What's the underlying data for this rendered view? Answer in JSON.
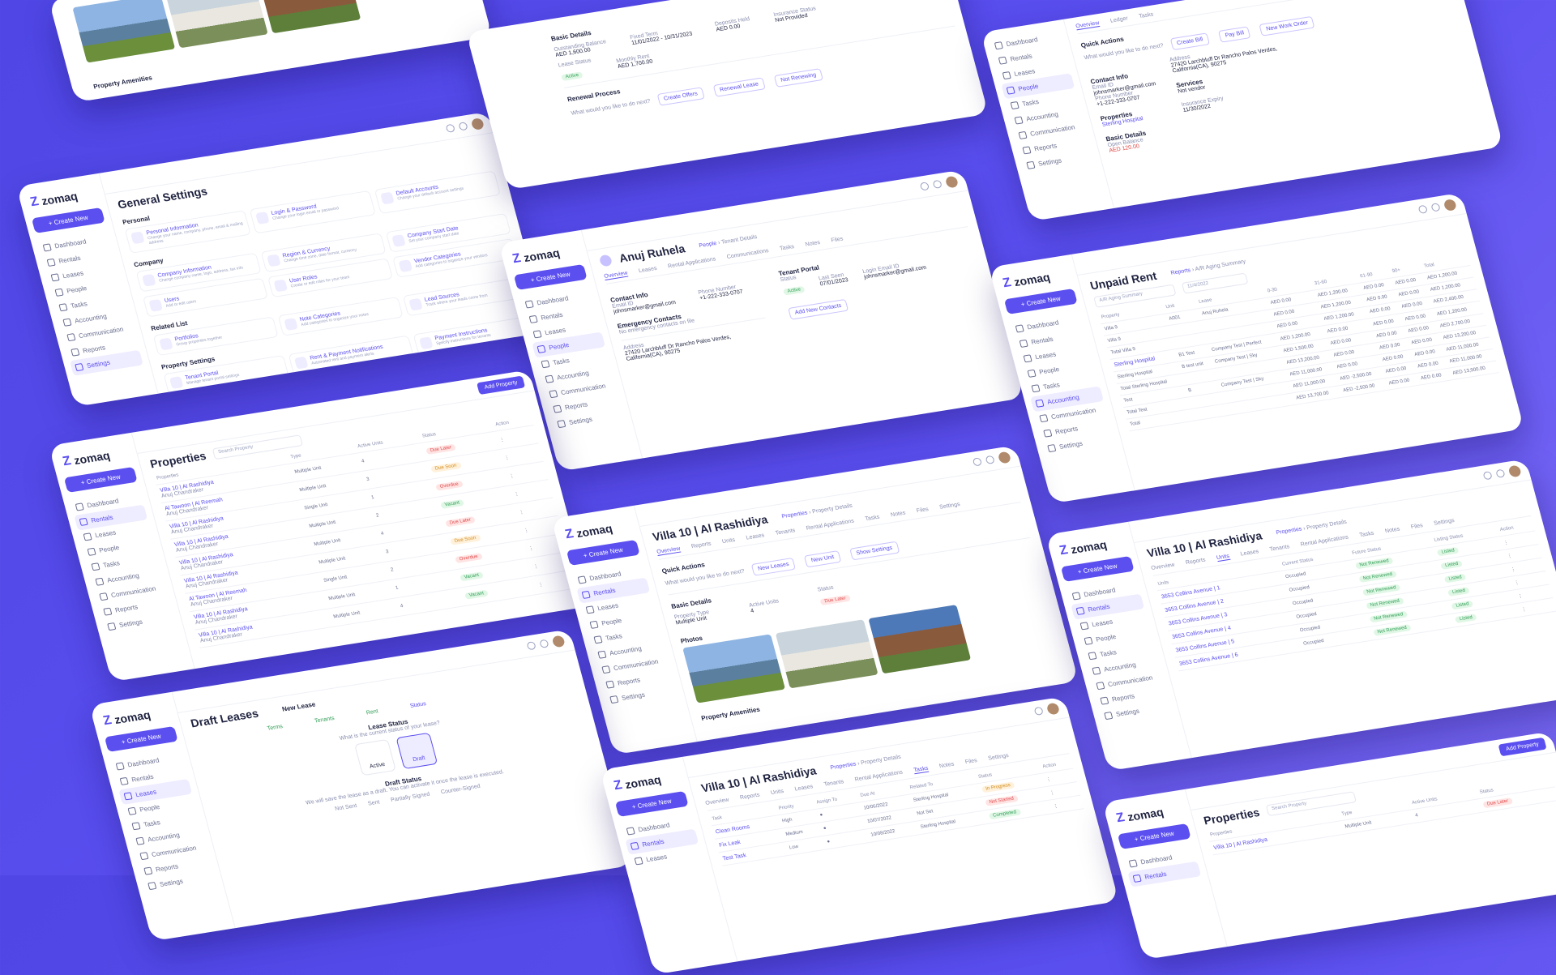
{
  "brand": {
    "name": "zomaq",
    "cta": "+ Create New"
  },
  "nav": [
    "Dashboard",
    "Rentals",
    "Leases",
    "People",
    "Tasks",
    "Accounting",
    "Communication",
    "Reports",
    "Settings"
  ],
  "general_settings": {
    "title": "General Settings",
    "personal": "Personal",
    "company": "Company",
    "related": "Related List",
    "property": "Property Settings",
    "tiles": [
      {
        "t": "Personal Information",
        "d": "Change your name, company, phone, email & mailing address"
      },
      {
        "t": "Login & Password",
        "d": "Change your login email or password"
      },
      {
        "t": "Default Accounts",
        "d": "Change your default account settings"
      },
      {
        "t": "Company Information",
        "d": "Change company name, logo, address, tax info"
      },
      {
        "t": "Region & Currency",
        "d": "Change time zone, date format, currency"
      },
      {
        "t": "Company Start Date",
        "d": "Set your company start date"
      },
      {
        "t": "Users",
        "d": "Add or edit users"
      },
      {
        "t": "User Roles",
        "d": "Create or edit roles for your team"
      },
      {
        "t": "Vendor Categories",
        "d": "Add categories to organize your vendors"
      },
      {
        "t": "Portfolios",
        "d": "Group properties together"
      },
      {
        "t": "Note Categories",
        "d": "Add categories to organize your notes"
      },
      {
        "t": "Lead Sources",
        "d": "Track where your leads come from"
      },
      {
        "t": "Tenant Portal",
        "d": "Manage tenant portal settings"
      },
      {
        "t": "Rent & Payment Notifications",
        "d": "Automated rent and payment alerts"
      },
      {
        "t": "Payment Instructions",
        "d": "Specify instructions for tenants"
      }
    ]
  },
  "renewal": {
    "basic": "Basic Details",
    "outstanding_label": "Outstanding Balance",
    "outstanding": "AED 1,600.00",
    "fixed_term_label": "Fixed Term",
    "fixed_term": "11/01/2022 - 10/31/2023",
    "rent_label": "Monthly Rent",
    "rent": "AED 1,700.00",
    "deposit_label": "Deposits Held",
    "deposit": "AED 0.00",
    "insurance_label": "Insurance Status",
    "insurance": "Not Provided",
    "lease_status_label": "Lease Status",
    "lease_status": "Active",
    "renewal_title": "Renewal Process",
    "question": "What would you like to do next?",
    "actions": [
      "Create Offers",
      "Renewal Lease",
      "Not Renewing"
    ]
  },
  "tenant_quick": {
    "tabs": [
      "Overview",
      "Ledger",
      "Tasks"
    ],
    "quick": "Quick Actions",
    "question": "What would you like to do next?",
    "actions": [
      "Create Bill",
      "Pay Bill",
      "New Work Order"
    ],
    "contact": "Contact Info",
    "email_label": "Email ID",
    "email": "johnsmarker@gmail.com",
    "phone_label": "Phone Number",
    "phone": "+1-222-333-0707",
    "address_label": "Address",
    "address": "27420 Larchbluff Dr Rancho Palos Verdes, California(CA), 90275",
    "services": "Services",
    "services_val": "Not vendor",
    "properties": "Properties",
    "property": "Sterling Hospital",
    "basic": "Basic Details",
    "opening_label": "Open Balance",
    "opening": "AED 120.00",
    "ins_label": "Insurance Expiry",
    "ins": "11/30/2022"
  },
  "person": {
    "name": "Anuj Ruhela",
    "crumb_a": "People",
    "crumb_b": "Tenant Details",
    "tabs": [
      "Overview",
      "Leases",
      "Rental Applications",
      "Communications",
      "Tasks",
      "Notes",
      "Files"
    ],
    "contact": "Contact Info",
    "email_label": "Email ID",
    "email": "johnsmarker@gmail.com",
    "phone_label": "Phone Number",
    "phone": "+1-222-333-0707",
    "portal": "Tenant Portal",
    "status_label": "Status",
    "status": "Active",
    "last_seen_label": "Last Seen",
    "last_seen": "07/01/2023",
    "login_label": "Login Email ID",
    "login": "johnsmarker@gmail.com",
    "add_contact": "Add New Contacts",
    "emergency": "Emergency Contacts",
    "emergency_empty": "No emergency contacts on file",
    "address_label": "Address",
    "address": "27420 Larchbluff Dr Rancho Palos Verdes, California(CA), 90275"
  },
  "unpaid": {
    "title": "Unpaid Rent",
    "crumb_a": "Reports",
    "crumb_b": "A/R Aging Summary",
    "filter": "A/R Aging Summary",
    "date": "11/4/2022",
    "cols": [
      "Property",
      "Unit",
      "Lease",
      "0-30",
      "31-60",
      "61-90",
      "90+",
      "Total"
    ],
    "rows": [
      [
        "Villa 9",
        "A001",
        "Anuj Ruhela",
        "AED 0.00",
        "AED 1,200.00",
        "AED 0.00",
        "AED 0.00",
        "AED 1,200.00"
      ],
      [
        "Villa 9",
        "",
        "",
        "AED 0.00",
        "AED 1,200.00",
        "AED 0.00",
        "AED 0.00",
        "AED 1,200.00"
      ],
      [
        "Total Villa 9",
        "",
        "",
        "AED 0.00",
        "AED 1,200.00",
        "AED 0.00",
        "AED 0.00",
        "AED 2,400.00"
      ],
      [
        "Sterling Hospital",
        "B1 Test",
        "Company Test | Perfect",
        "AED 1,200.00",
        "AED 0.00",
        "AED 0.00",
        "AED 0.00",
        "AED 1,200.00"
      ],
      [
        "Sterling Hospital",
        "B test unit",
        "Company Test | Sky",
        "AED 1,500.00",
        "AED 0.00",
        "AED 0.00",
        "AED 0.00",
        "AED 2,700.00"
      ],
      [
        "Total Sterling Hospital",
        "",
        "",
        "AED 13,200.00",
        "AED 0.00",
        "AED 0.00",
        "AED 0.00",
        "AED 13,200.00"
      ],
      [
        "Test",
        "B",
        "Company Test | Sky",
        "AED 11,000.00",
        "AED 0.00",
        "AED 0.00",
        "AED 0.00",
        "AED 11,000.00"
      ],
      [
        "Total Test",
        "",
        "",
        "AED 11,000.00",
        "AED -2,500.00",
        "AED 0.00",
        "AED 0.00",
        "AED 11,000.00"
      ],
      [
        "Total",
        "",
        "",
        "AED 13,700.00",
        "AED -2,500.00",
        "AED 0.00",
        "AED 0.00",
        "AED 13,900.00"
      ]
    ]
  },
  "properties": {
    "title": "Properties",
    "search": "Search Property",
    "add": "Add Property",
    "cols": [
      "Properties",
      "Type",
      "Active Units",
      "Status",
      "Action"
    ],
    "rows": [
      {
        "name": "Villa 10 | Al Rashidiya",
        "sub": "Anuj Chandraker",
        "type": "Multiple Unit",
        "units": "4",
        "status": "Due Later",
        "tone": "red"
      },
      {
        "name": "Al Tawoon | Al Reemah",
        "sub": "Anuj Chandraker",
        "type": "Multiple Unit",
        "units": "3",
        "status": "Due Soon",
        "tone": "amb"
      },
      {
        "name": "Villa 10 | Al Rashidiya",
        "sub": "Anuj Chandraker",
        "type": "Single Unit",
        "units": "1",
        "status": "Overdue",
        "tone": "red"
      },
      {
        "name": "Villa 10 | Al Rashidiya",
        "sub": "Anuj Chandraker",
        "type": "Multiple Unit",
        "units": "2",
        "status": "Vacant",
        "tone": "green"
      },
      {
        "name": "Villa 10 | Al Rashidiya",
        "sub": "Anuj Chandraker",
        "type": "Multiple Unit",
        "units": "4",
        "status": "Due Later",
        "tone": "red"
      },
      {
        "name": "Villa 10 | Al Rashidiya",
        "sub": "Anuj Chandraker",
        "type": "Multiple Unit",
        "units": "3",
        "status": "Due Soon",
        "tone": "amb"
      },
      {
        "name": "Al Tawoon | Al Reemah",
        "sub": "Anuj Chandraker",
        "type": "Single Unit",
        "units": "2",
        "status": "Overdue",
        "tone": "red"
      },
      {
        "name": "Villa 10 | Al Rashidiya",
        "sub": "Anuj Chandraker",
        "type": "Multiple Unit",
        "units": "1",
        "status": "Vacant",
        "tone": "green"
      },
      {
        "name": "Villa 10 | Al Rashidiya",
        "sub": "Anuj Chandraker",
        "type": "Multiple Unit",
        "units": "4",
        "status": "Vacant",
        "tone": "green"
      }
    ]
  },
  "villa": {
    "title": "Villa 10 | Al Rashidiya",
    "crumb_a": "Properties",
    "crumb_b": "Property Details",
    "tabs": [
      "Overview",
      "Reports",
      "Units",
      "Leases",
      "Tenants",
      "Rental Applications",
      "Tasks",
      "Notes",
      "Files",
      "Settings"
    ],
    "quick": "Quick Actions",
    "question": "What would you like to do next?",
    "actions": [
      "New Leases",
      "New Unit",
      "Show Settings"
    ],
    "basic": "Basic Details",
    "active_units_label": "Active Units",
    "active_units": "4",
    "status_label": "Status",
    "status": "Due Later",
    "type_label": "Property Type",
    "type": "Multiple Unit",
    "photos": "Photos",
    "amenities": "Property Amenities"
  },
  "units": {
    "title": "Villa 10 | Al Rashidiya",
    "crumb_a": "Properties",
    "crumb_b": "Property Details",
    "tabs": [
      "Overview",
      "Reports",
      "Units",
      "Leases",
      "Tenants",
      "Rental Applications",
      "Tasks",
      "Notes",
      "Files",
      "Settings"
    ],
    "cols": [
      "Units",
      "Current Status",
      "Future Status",
      "Listing Status",
      "Action"
    ],
    "rows": [
      {
        "u": "3653 Collins Avenue | 1",
        "cur": "Occupied",
        "fut": "Not Renewed",
        "list": "Listed"
      },
      {
        "u": "3653 Collins Avenue | 2",
        "cur": "Occupied",
        "fut": "Not Renewed",
        "list": "Listed"
      },
      {
        "u": "3653 Collins Avenue | 3",
        "cur": "Occupied",
        "fut": "Not Renewed",
        "list": "Listed"
      },
      {
        "u": "3653 Collins Avenue | 4",
        "cur": "Occupied",
        "fut": "Not Renewed",
        "list": "Listed"
      },
      {
        "u": "3653 Collins Avenue | 5",
        "cur": "Occupied",
        "fut": "Not Renewed",
        "list": "Listed"
      },
      {
        "u": "3653 Collins Avenue | 6",
        "cur": "Occupied",
        "fut": "Not Renewed",
        "list": "Listed"
      }
    ]
  },
  "draft": {
    "title": "Draft Leases",
    "sub": "New Lease",
    "steps": [
      "Terms",
      "Tenants",
      "Rent",
      "Status"
    ],
    "lease_status": "Lease Status",
    "question": "What is the current status of your lease?",
    "opt_active": "Active",
    "opt_draft": "Draft",
    "draft_status": "Draft Status",
    "draft_note": "We will save the lease as a draft. You can activate it once the lease is executed.",
    "draft_opts": [
      "Not Sent",
      "Sent",
      "Partially Signed",
      "Counter-Signed"
    ]
  },
  "tasks": {
    "title": "Villa 10 | Al Rashidiya",
    "crumb_a": "Properties",
    "crumb_b": "Property Details",
    "tabs": [
      "Overview",
      "Reports",
      "Units",
      "Leases",
      "Tenants",
      "Rental Applications",
      "Tasks",
      "Notes",
      "Files",
      "Settings"
    ],
    "cols": [
      "Task",
      "Priority",
      "Assign To",
      "Due At",
      "Related To",
      "Status",
      "Action"
    ],
    "rows": [
      {
        "task": "Clean Rooms",
        "pri": "High",
        "due": "10/06/2022",
        "rel": "Sterling Hospital",
        "status": "In Progress"
      },
      {
        "task": "Fix Leak",
        "pri": "Medium",
        "due": "10/07/2022",
        "rel": "Not Set",
        "status": "Not Started"
      },
      {
        "task": "Test Task",
        "pri": "Low",
        "due": "10/08/2022",
        "rel": "Sterling Hospital",
        "status": "Completed"
      }
    ]
  },
  "properties_small": {
    "title": "Properties",
    "search": "Search Property",
    "add": "Add Property",
    "row": "Villa 10 | Al Rashidiya",
    "type": "Multiple Unit",
    "units": "4",
    "status": "Due Later"
  }
}
